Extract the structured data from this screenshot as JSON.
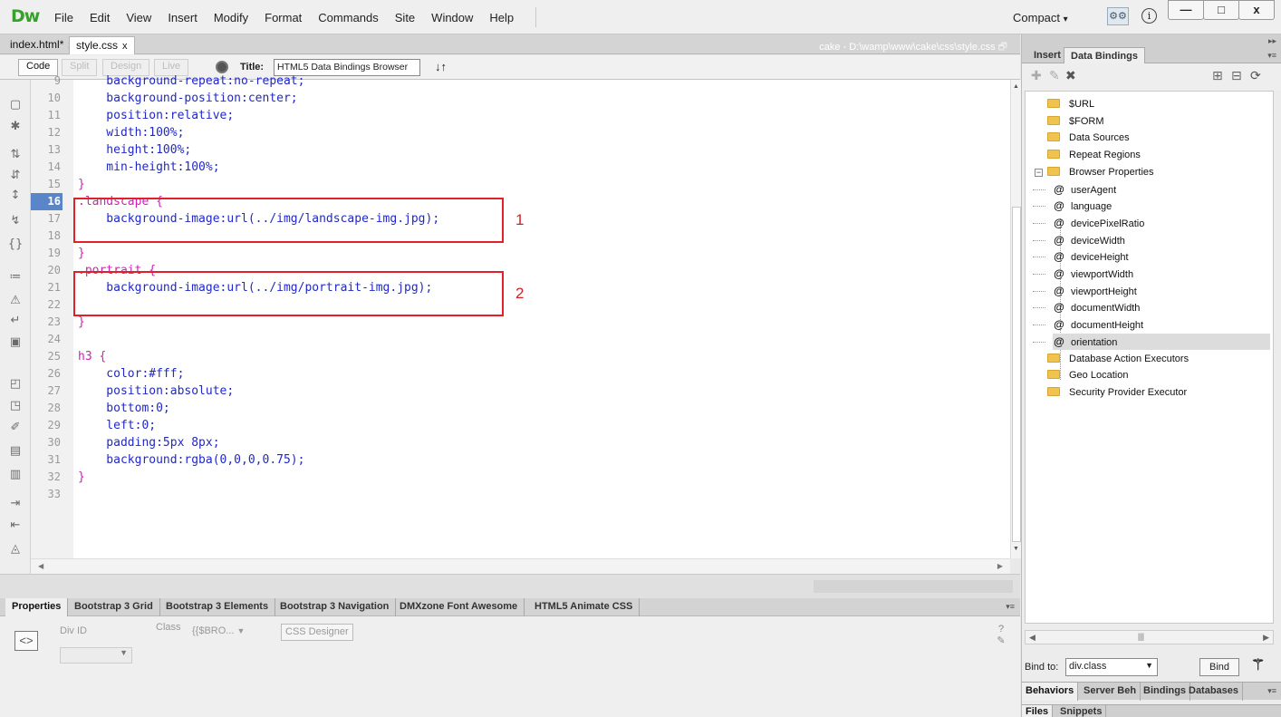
{
  "app": {
    "logo": "Dw",
    "menus": [
      "File",
      "Edit",
      "View",
      "Insert",
      "Modify",
      "Format",
      "Commands",
      "Site",
      "Window",
      "Help"
    ],
    "workspace": "Compact",
    "workspace_arrow": "▾"
  },
  "window_controls": {
    "minimize": "—",
    "maximize": "□",
    "close": "x"
  },
  "doc_tabs": [
    {
      "label": "index.html*",
      "close": "x"
    },
    {
      "label": "style.css",
      "close": "x"
    }
  ],
  "file_path": "cake - D:\\wamp\\www\\cake\\css\\style.css",
  "view_buttons": {
    "code": "Code",
    "split": "Split",
    "design": "Design",
    "live": "Live"
  },
  "doc_title": {
    "label": "Title:",
    "value": "HTML5 Data Bindings Browser"
  },
  "editor": {
    "current_line": "16",
    "lines": [
      {
        "n": "9",
        "t": "    background-repeat:no-repeat;",
        "c": "blue"
      },
      {
        "n": "10",
        "t": "    background-position:center;",
        "c": "blue"
      },
      {
        "n": "11",
        "t": "    position:relative;",
        "c": "blue"
      },
      {
        "n": "12",
        "t": "    width:100%;",
        "c": "blue"
      },
      {
        "n": "13",
        "t": "    height:100%;",
        "c": "blue"
      },
      {
        "n": "14",
        "t": "    min-height:100%;",
        "c": "blue"
      },
      {
        "n": "15",
        "t": "}",
        "c": "pink"
      },
      {
        "n": "16",
        "t": ".landscape {",
        "c": "pink"
      },
      {
        "n": "17",
        "t": "    background-image:url(../img/landscape-img.jpg);",
        "c": "blue"
      },
      {
        "n": "18",
        "t": "",
        "c": "blue"
      },
      {
        "n": "19",
        "t": "}",
        "c": "pink"
      },
      {
        "n": "20",
        "t": ".portrait {",
        "c": "pink"
      },
      {
        "n": "21",
        "t": "    background-image:url(../img/portrait-img.jpg);",
        "c": "blue"
      },
      {
        "n": "22",
        "t": "",
        "c": "blue"
      },
      {
        "n": "23",
        "t": "}",
        "c": "pink"
      },
      {
        "n": "24",
        "t": "",
        "c": "blue"
      },
      {
        "n": "25",
        "t": "h3 {",
        "c": "pink"
      },
      {
        "n": "26",
        "t": "    color:#fff;",
        "c": "blue"
      },
      {
        "n": "27",
        "t": "    position:absolute;",
        "c": "blue"
      },
      {
        "n": "28",
        "t": "    bottom:0;",
        "c": "blue"
      },
      {
        "n": "29",
        "t": "    left:0;",
        "c": "blue"
      },
      {
        "n": "30",
        "t": "    padding:5px 8px;",
        "c": "blue"
      },
      {
        "n": "31",
        "t": "    background:rgba(0,0,0,0.75);",
        "c": "blue"
      },
      {
        "n": "32",
        "t": "}",
        "c": "pink"
      },
      {
        "n": "33",
        "t": "",
        "c": "blue"
      }
    ],
    "annotations": [
      "1",
      "2"
    ]
  },
  "properties_tabs": [
    "Properties",
    "Bootstrap 3 Grid",
    "Bootstrap 3 Elements",
    "Bootstrap 3 Navigation",
    "DMXzone Font Awesome",
    "HTML5 Animate CSS"
  ],
  "properties": {
    "div_id_label": "Div ID",
    "class_label": "Class",
    "class_value": "{{$BRO...",
    "css_designer": "CSS Designer"
  },
  "right_panel": {
    "tabs": [
      "Insert",
      "Data Bindings"
    ],
    "tree": [
      {
        "label": "$URL",
        "type": "folder"
      },
      {
        "label": "$FORM",
        "type": "folder"
      },
      {
        "label": "Data Sources",
        "type": "folder"
      },
      {
        "label": "Repeat Regions",
        "type": "folder"
      },
      {
        "label": "Browser Properties",
        "type": "folder-open"
      },
      {
        "label": "userAgent",
        "type": "prop"
      },
      {
        "label": "language",
        "type": "prop"
      },
      {
        "label": "devicePixelRatio",
        "type": "prop"
      },
      {
        "label": "deviceWidth",
        "type": "prop"
      },
      {
        "label": "deviceHeight",
        "type": "prop"
      },
      {
        "label": "viewportWidth",
        "type": "prop"
      },
      {
        "label": "viewportHeight",
        "type": "prop"
      },
      {
        "label": "documentWidth",
        "type": "prop"
      },
      {
        "label": "documentHeight",
        "type": "prop"
      },
      {
        "label": "orientation",
        "type": "prop",
        "selected": true
      },
      {
        "label": "Database Action Executors",
        "type": "folder"
      },
      {
        "label": "Geo Location",
        "type": "folder"
      },
      {
        "label": "Security Provider Executor",
        "type": "folder"
      }
    ],
    "bind_to_label": "Bind to:",
    "bind_to_value": "div.class",
    "bind_button": "Bind",
    "bottom_tabs": [
      "Behaviors",
      "Server Beh",
      "Bindings",
      "Databases"
    ],
    "bottom_tabs2": [
      "Files",
      "Snippets"
    ]
  }
}
